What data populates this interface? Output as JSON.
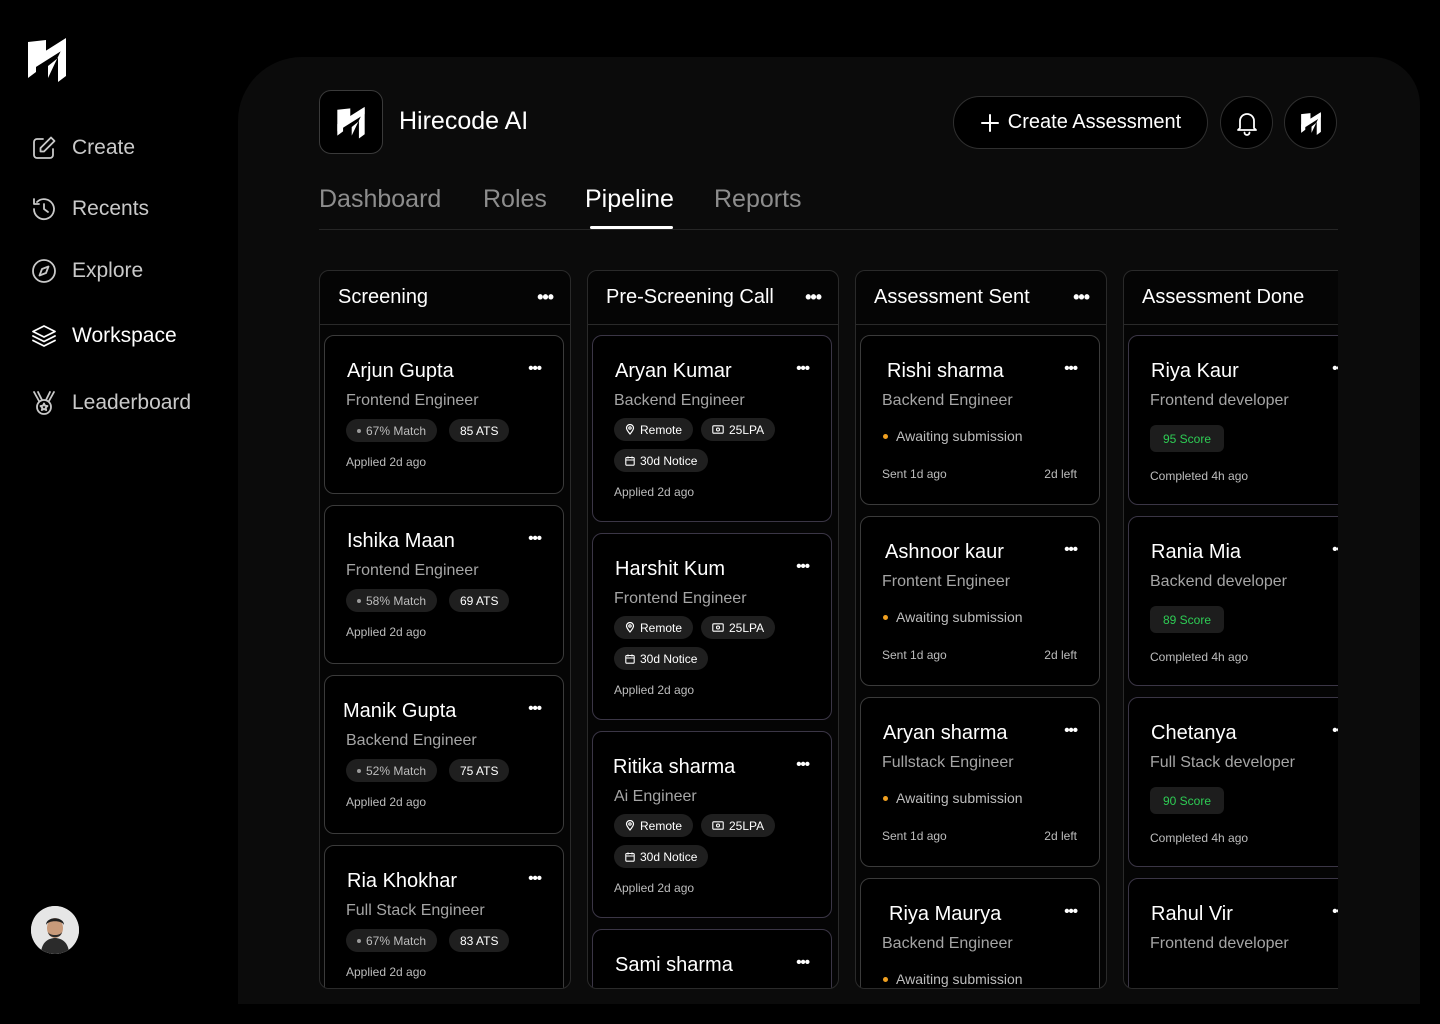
{
  "sidebar": {
    "items": [
      {
        "label": "Create",
        "icon": "edit-icon"
      },
      {
        "label": "Recents",
        "icon": "history-icon"
      },
      {
        "label": "Explore",
        "icon": "compass-icon"
      },
      {
        "label": "Workspace",
        "icon": "layers-icon",
        "active": true
      },
      {
        "label": "Leaderboard",
        "icon": "medal-icon"
      }
    ]
  },
  "header": {
    "brand": "Hirecode AI",
    "create_label": "Create Assessment"
  },
  "tabs": [
    "Dashboard",
    "Roles",
    "Pipeline",
    "Reports"
  ],
  "active_tab": "Pipeline",
  "columns": {
    "screening": {
      "title": "Screening",
      "cards": [
        {
          "name": "Arjun Gupta",
          "role": "Frontend Engineer",
          "match": "67% Match",
          "ats": "85 ATS",
          "applied": "Applied 2d ago"
        },
        {
          "name": "Ishika Maan",
          "role": "Frontend Engineer",
          "match": "58% Match",
          "ats": "69 ATS",
          "applied": "Applied 2d ago"
        },
        {
          "name": "Manik Gupta",
          "role": "Backend Engineer",
          "match": "52% Match",
          "ats": "75 ATS",
          "applied": "Applied 2d ago"
        },
        {
          "name": "Ria Khokhar",
          "role": "Full Stack Engineer",
          "match": "67% Match",
          "ats": "83 ATS",
          "applied": "Applied 2d ago"
        }
      ]
    },
    "prescreen": {
      "title": "Pre-Screening Call",
      "cards": [
        {
          "name": "Aryan Kumar",
          "role": "Backend Engineer",
          "location": "Remote",
          "salary": "25LPA",
          "notice": "30d Notice",
          "applied": "Applied 2d ago"
        },
        {
          "name": "Harshit Kum",
          "role": "Frontend Engineer",
          "location": "Remote",
          "salary": "25LPA",
          "notice": "30d Notice",
          "applied": "Applied 2d ago"
        },
        {
          "name": "Ritika sharma",
          "role": "Ai Engineer",
          "location": "Remote",
          "salary": "25LPA",
          "notice": "30d Notice",
          "applied": "Applied 2d ago"
        },
        {
          "name": "Sami sharma"
        }
      ]
    },
    "sent": {
      "title": "Assessment Sent",
      "cards": [
        {
          "name": "Rishi sharma",
          "role": "Backend Engineer",
          "status": "Awaiting submission",
          "sent": "Sent 1d ago",
          "left": "2d left"
        },
        {
          "name": "Ashnoor kaur",
          "role": "Frontent Engineer",
          "status": "Awaiting submission",
          "sent": "Sent 1d ago",
          "left": "2d left"
        },
        {
          "name": "Aryan sharma",
          "role": "Fullstack  Engineer",
          "status": "Awaiting submission",
          "sent": "Sent 1d ago",
          "left": "2d left"
        },
        {
          "name": "Riya Maurya",
          "role": "Backend Engineer",
          "status": "Awaiting submission"
        }
      ]
    },
    "done": {
      "title": "Assessment Done",
      "cards": [
        {
          "name": "Riya Kaur",
          "role": "Frontend developer",
          "score": "95 Score",
          "completed": "Completed 4h ago"
        },
        {
          "name": "Rania Mia",
          "role": "Backend developer",
          "score": "89 Score",
          "completed": "Completed 4h ago"
        },
        {
          "name": "Chetanya",
          "role": "Full Stack developer",
          "score": "90 Score",
          "completed": "Completed 4h ago"
        },
        {
          "name": "Rahul Vir",
          "role": "Frontend developer"
        }
      ]
    }
  },
  "colors": {
    "accent_green": "#2ecc54",
    "status_orange": "#f0a020"
  }
}
